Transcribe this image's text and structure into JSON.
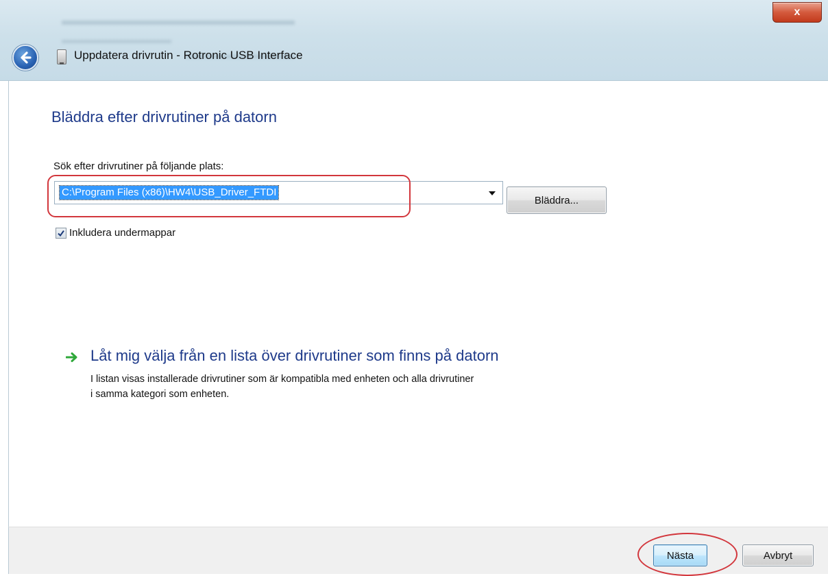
{
  "window": {
    "title": "Uppdatera drivrutin - Rotronic USB Interface",
    "close_label": "x"
  },
  "main": {
    "heading": "Bläddra efter drivrutiner på datorn",
    "search_label": "Sök efter drivrutiner på följande plats:",
    "path_value": "C:\\Program Files (x86)\\HW4\\USB_Driver_FTDI",
    "browse_label": "Bläddra...",
    "include_subfolders_label": "Inkludera undermappar",
    "include_subfolders_checked": true
  },
  "link": {
    "title": "Låt mig välja från en lista över drivrutiner som finns på datorn",
    "description_line1": "I listan visas installerade drivrutiner som är kompatibla med enheten och alla drivrutiner",
    "description_line2": "i samma kategori som enheten."
  },
  "footer": {
    "next_label": "Nästa",
    "cancel_label": "Avbryt"
  },
  "colors": {
    "heading": "#1e3a8a",
    "selection": "#3399ff",
    "highlight": "#d2363c",
    "arrow": "#2fa83a"
  },
  "icons": {
    "back": "back-arrow-icon",
    "device": "usb-device-icon",
    "link_arrow": "green-arrow-icon",
    "dropdown": "chevron-down-icon",
    "checkbox": "checkmark-icon"
  }
}
